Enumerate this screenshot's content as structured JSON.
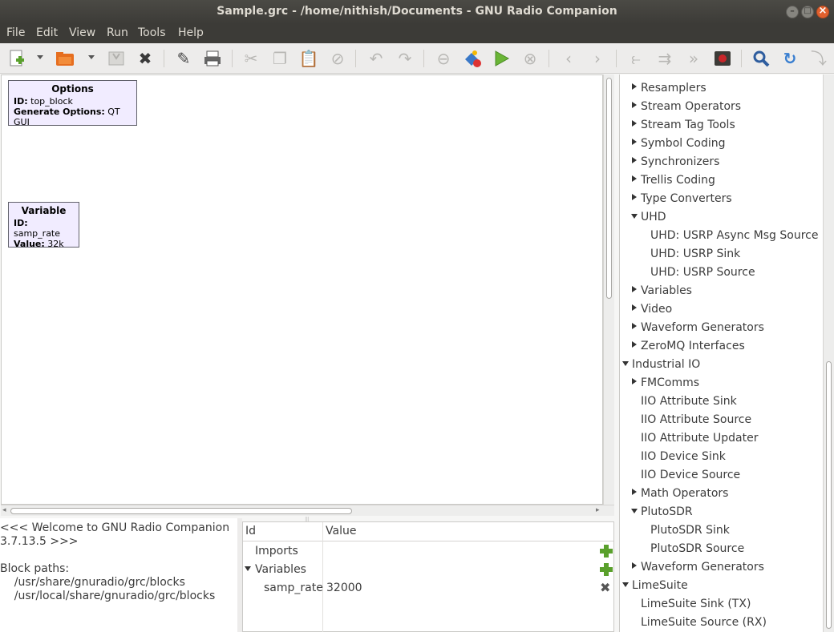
{
  "window": {
    "title": "Sample.grc - /home/nithish/Documents - GNU Radio Companion"
  },
  "menubar": [
    "File",
    "Edit",
    "View",
    "Run",
    "Tools",
    "Help"
  ],
  "toolbar": {
    "icons": [
      "new-icon",
      "open-icon",
      "save-icon",
      "close-icon",
      "edit-icon",
      "print-icon",
      "cut-icon",
      "copy-icon",
      "paste-icon",
      "disable-icon",
      "undo-icon",
      "redo-icon",
      "errors-icon",
      "generate-icon",
      "execute-icon",
      "kill-icon",
      "rotate-left-icon",
      "rotate-right-icon",
      "enable-icon",
      "bypass-icon",
      "forward-icon",
      "screenshot-icon",
      "find-icon",
      "reload-icon",
      "more-icon"
    ]
  },
  "canvas": {
    "blocks": [
      {
        "title": "Options",
        "params": [
          {
            "key": "ID:",
            "value": "top_block"
          },
          {
            "key": "Generate Options:",
            "value": "QT GUI"
          }
        ]
      },
      {
        "title": "Variable",
        "params": [
          {
            "key": "ID:",
            "value": "samp_rate"
          },
          {
            "key": "Value:",
            "value": "32k"
          }
        ]
      }
    ]
  },
  "tree": {
    "items": [
      {
        "label": "Resamplers",
        "state": "collapsed"
      },
      {
        "label": "Stream Operators",
        "state": "collapsed"
      },
      {
        "label": "Stream Tag Tools",
        "state": "collapsed"
      },
      {
        "label": "Symbol Coding",
        "state": "collapsed"
      },
      {
        "label": "Synchronizers",
        "state": "collapsed"
      },
      {
        "label": "Trellis Coding",
        "state": "collapsed"
      },
      {
        "label": "Type Converters",
        "state": "collapsed"
      },
      {
        "label": "UHD",
        "state": "expanded"
      },
      {
        "label": "UHD: USRP Async Msg Source",
        "state": "leaf"
      },
      {
        "label": "UHD: USRP Sink",
        "state": "leaf"
      },
      {
        "label": "UHD: USRP Source",
        "state": "leaf"
      },
      {
        "label": "Variables",
        "state": "collapsed"
      },
      {
        "label": "Video",
        "state": "collapsed"
      },
      {
        "label": "Waveform Generators",
        "state": "collapsed"
      },
      {
        "label": "ZeroMQ Interfaces",
        "state": "collapsed"
      },
      {
        "label": "Industrial IO",
        "state": "expanded"
      },
      {
        "label": "FMComms",
        "state": "collapsed"
      },
      {
        "label": "IIO Attribute Sink",
        "state": "leaf"
      },
      {
        "label": "IIO Attribute Source",
        "state": "leaf"
      },
      {
        "label": "IIO Attribute Updater",
        "state": "leaf"
      },
      {
        "label": "IIO Device Sink",
        "state": "leaf"
      },
      {
        "label": "IIO Device Source",
        "state": "leaf"
      },
      {
        "label": "Math Operators",
        "state": "collapsed"
      },
      {
        "label": "PlutoSDR",
        "state": "expanded"
      },
      {
        "label": "PlutoSDR Sink",
        "state": "leaf"
      },
      {
        "label": "PlutoSDR Source",
        "state": "leaf"
      },
      {
        "label": "Waveform Generators",
        "state": "collapsed"
      },
      {
        "label": "LimeSuite",
        "state": "expanded"
      },
      {
        "label": "LimeSuite Sink (TX)",
        "state": "leaf"
      },
      {
        "label": "LimeSuite Source (RX)",
        "state": "leaf"
      }
    ]
  },
  "console": {
    "lines": [
      "<<< Welcome to GNU Radio Companion",
      "3.7.13.5 >>>",
      "",
      "Block paths:",
      "    /usr/share/gnuradio/grc/blocks",
      "    /usr/local/share/gnuradio/grc/blocks"
    ]
  },
  "variables_panel": {
    "headers": {
      "id": "Id",
      "value": "Value"
    },
    "rows": [
      {
        "id": "Imports",
        "value": "",
        "action": "add"
      },
      {
        "id": "Variables",
        "value": "",
        "action": "add"
      },
      {
        "id": "samp_rate",
        "value": "32000",
        "action": "remove"
      }
    ]
  }
}
